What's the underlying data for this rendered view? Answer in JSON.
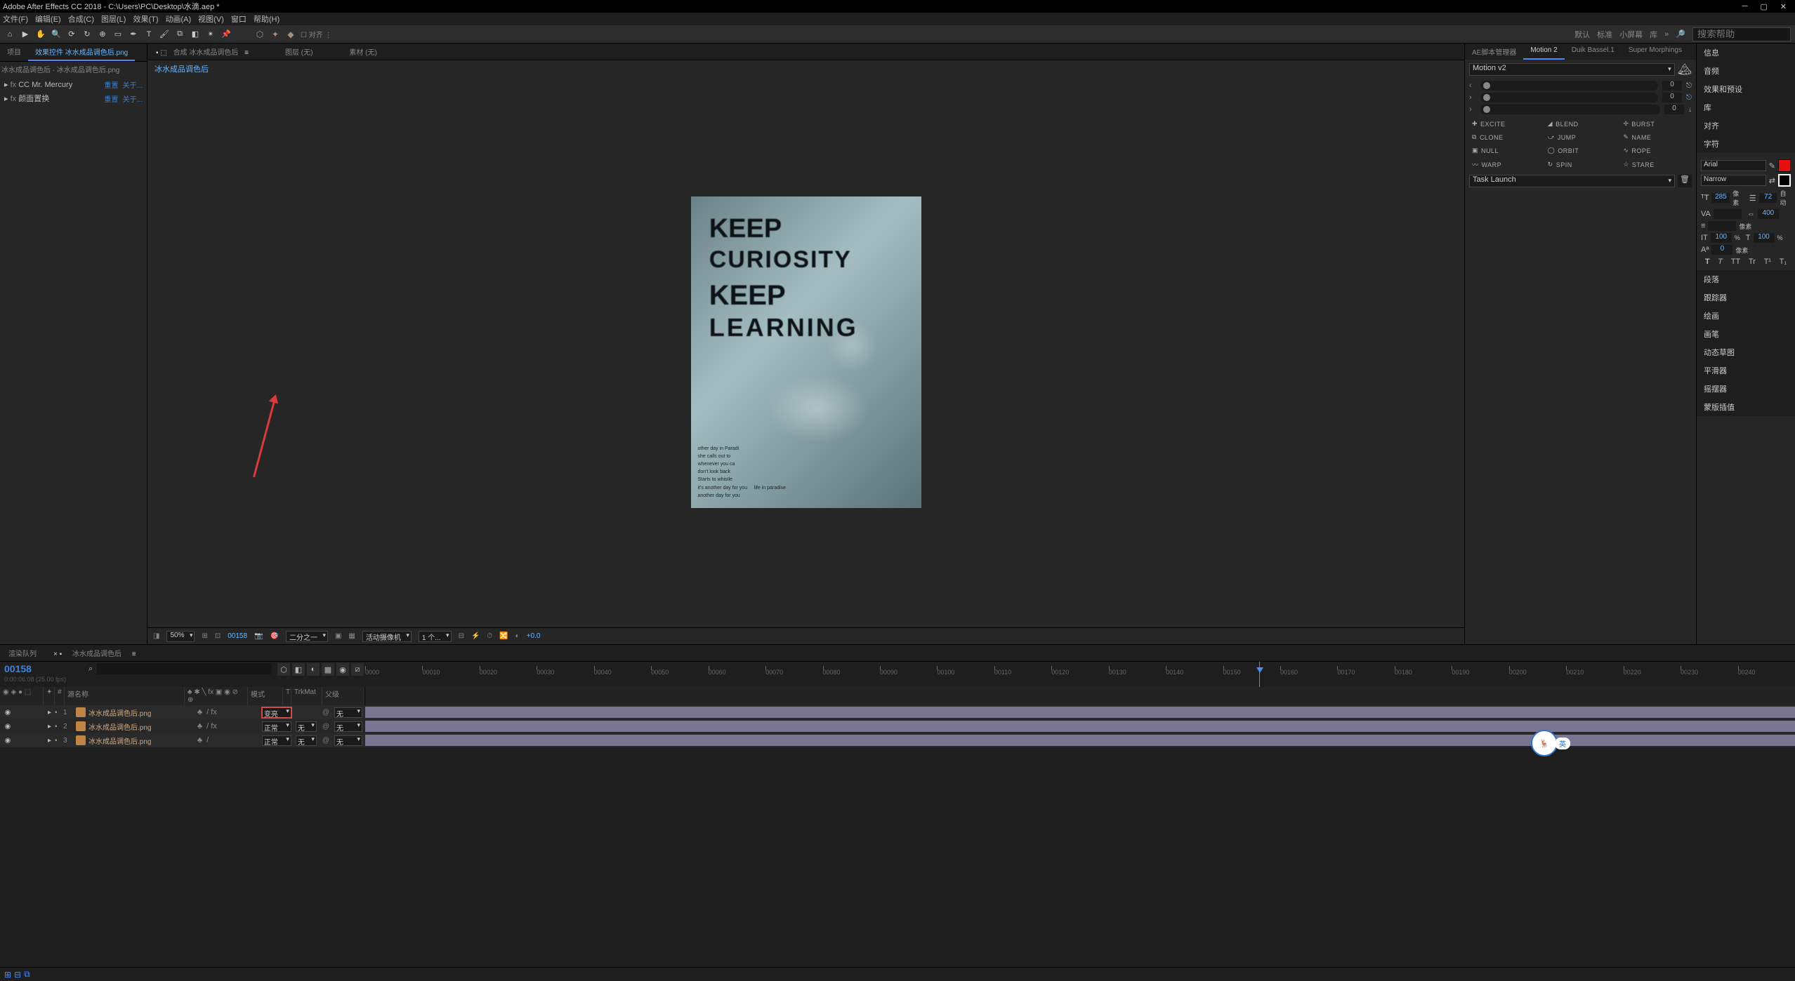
{
  "title_bar": "Adobe After Effects CC 2018 - C:\\Users\\PC\\Desktop\\水滴.aep *",
  "menu": [
    "文件(F)",
    "编辑(E)",
    "合成(C)",
    "图层(L)",
    "效果(T)",
    "动画(A)",
    "视图(V)",
    "窗口",
    "帮助(H)"
  ],
  "toolbar": {
    "snapping": "对齐"
  },
  "workspace_menu": {
    "default": "默认",
    "standard": "标准",
    "small": "小屏幕",
    "library": "库",
    "search_placeholder": "搜索帮助"
  },
  "left_panel": {
    "tabs": [
      "项目",
      "效果控件 冰水成品调色后.png"
    ],
    "active": 1,
    "breadcrumb": "冰水成品调色后 · 冰水成品调色后.png",
    "fx": [
      {
        "name": "CC Mr. Mercury",
        "reset": "重置",
        "about": "关于..."
      },
      {
        "name": "颜面置换",
        "reset": "重置",
        "about": "关于..."
      }
    ]
  },
  "center": {
    "tabs": {
      "comp": "合成 冰水成品调色后",
      "layout": "图层 (无)",
      "material": "素材 (无)"
    },
    "breadcrumb": "冰水成品调色后",
    "poster_lines": [
      "KEEP",
      "CURIOSITY",
      "KEEP",
      "LEARNING"
    ],
    "controls": {
      "zoom": "50%",
      "timecode": "00158",
      "res": "二分之一",
      "camera": "活动摄像机",
      "view": "1 个...",
      "exposure": "+0.0"
    }
  },
  "right": {
    "tabs": [
      "AE脚本管理器",
      "Motion 2",
      "Duik Bassel.1",
      "Super Morphings"
    ],
    "active": 1,
    "preset": "Motion v2",
    "sliders": [
      {
        "axis": "‹",
        "val": "0"
      },
      {
        "axis": "›",
        "val": "0"
      },
      {
        "axis": "›",
        "val": "0"
      }
    ],
    "actions": [
      "EXCITE",
      "BLEND",
      "BURST",
      "CLONE",
      "JUMP",
      "NAME",
      "NULL",
      "ORBIT",
      "ROPE",
      "WARP",
      "SPIN",
      "STARE"
    ],
    "task": "Task Launch"
  },
  "far_right": {
    "items_top": [
      "信息",
      "音频",
      "效果和预设",
      "库",
      "对齐"
    ],
    "char_header": "字符",
    "font": "Arial",
    "style": "Narrow",
    "size": "285",
    "leading": "72",
    "auto": "自动",
    "kerning": "",
    "tracking": "400",
    "vscale": "100",
    "hscale": "100",
    "pct": "%",
    "px": "像素",
    "baseline": "0",
    "tsume": "像素",
    "stroke": "像素",
    "faux": [
      "T",
      "T",
      "TT",
      "Tr",
      "T¹",
      "T₁"
    ],
    "items_bottom": [
      "段落",
      "跟踪器",
      "绘画",
      "画笔",
      "动态草图",
      "平滑器",
      "摇摆器",
      "蒙版插值"
    ]
  },
  "timeline": {
    "tabs": [
      "渲染队列",
      "冰水成品调色后"
    ],
    "time": "00158",
    "sub": "0:00:06:08 (25.00 fps)",
    "columns": {
      "source": "源名称",
      "mode": "模式",
      "trkmat": "TrkMat",
      "parent": "父级",
      "t": "T"
    },
    "ruler": [
      "0000",
      "00010",
      "00020",
      "00030",
      "00040",
      "00050",
      "00060",
      "00070",
      "00080",
      "00090",
      "00100",
      "00110",
      "00120",
      "00130",
      "00140",
      "00150",
      "00160",
      "00170",
      "00180",
      "00190",
      "00200",
      "00210",
      "00220",
      "00230",
      "00240"
    ],
    "layers": [
      {
        "idx": "1",
        "name": "冰水成品调色后.png",
        "mode": "变亮",
        "trk": "",
        "parent": "无"
      },
      {
        "idx": "2",
        "name": "冰水成品调色后.png",
        "mode": "正常",
        "trk": "无",
        "parent": "无"
      },
      {
        "idx": "3",
        "name": "冰水成品调色后.png",
        "mode": "正常",
        "trk": "无",
        "parent": "无"
      }
    ]
  },
  "floater": {
    "label": "英"
  }
}
